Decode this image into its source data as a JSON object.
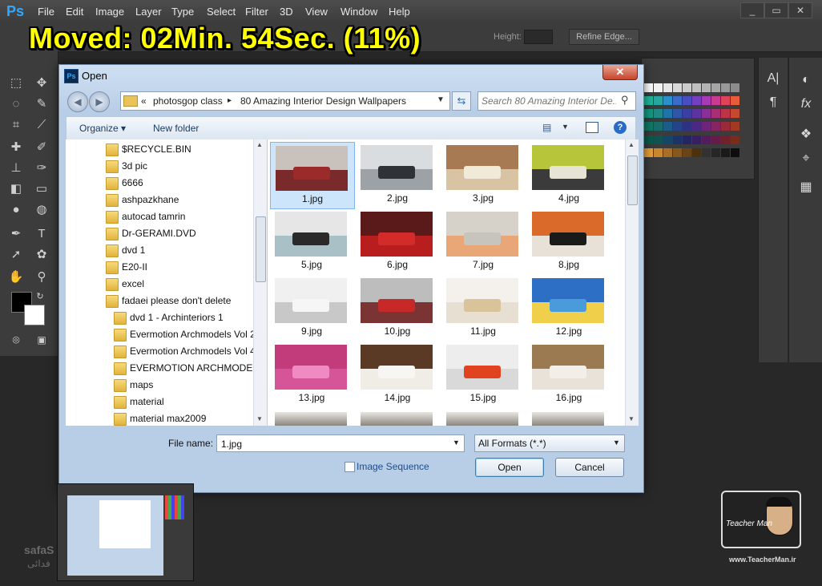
{
  "app": {
    "logo": "Ps",
    "menu": [
      "File",
      "Edit",
      "Image",
      "Layer",
      "Type",
      "Select",
      "Filter",
      "3D",
      "View",
      "Window",
      "Help"
    ],
    "window_buttons": [
      "_",
      "▭",
      "✕"
    ]
  },
  "overlay": {
    "banner": "Moved: 02Min. 54Sec. (11%)"
  },
  "options_bar": {
    "height_label": "Height:",
    "refine_edge": "Refine Edge..."
  },
  "tools": [
    "marquee-icon",
    "move-icon",
    "lasso-icon",
    "quick-select-icon",
    "crop-icon",
    "eyedropper-icon",
    "healing-icon",
    "brush-icon",
    "stamp-icon",
    "history-brush-icon",
    "eraser-icon",
    "gradient-icon",
    "blur-icon",
    "dodge-icon",
    "pen-icon",
    "type-icon",
    "path-select-icon",
    "shape-icon",
    "hand-icon",
    "zoom-icon"
  ],
  "tool_glyphs": {
    "type": "T",
    "type_alt": "A|",
    "paragraph": "¶",
    "fx": "fx"
  },
  "colors": {
    "foreground": "#000000",
    "background": "#ffffff",
    "ps_blue": "#31a8ff",
    "banner_yellow": "#ffff00"
  },
  "dialog": {
    "title": "Open",
    "address": {
      "chevron": "«",
      "parent": "photosgop class",
      "separator": "▸",
      "current": "80 Amazing Interior Design Wallpapers"
    },
    "search_placeholder": "Search 80 Amazing Interior De...",
    "organize": "Organize ▾",
    "new_folder": "New folder",
    "help": "?",
    "folders": [
      "$RECYCLE.BIN",
      "3d pic",
      "6666",
      "ashpazkhane",
      "autocad tamrin",
      "Dr-GERAMI.DVD",
      "dvd 1",
      "E20-II",
      "excel",
      "fadaei please don't delete",
      "dvd 1 - Archinteriors 1",
      "Evermotion Archmodels Vol 2",
      "Evermotion Archmodels Vol 4",
      "EVERMOTION ARCHMODELS",
      "maps",
      "material",
      "material max2009"
    ],
    "files": [
      {
        "name": "1.jpg",
        "top": "#c9c1bb",
        "bottom": "#7a2a2a",
        "obj": "#9b2b2b"
      },
      {
        "name": "2.jpg",
        "top": "#d9dde0",
        "bottom": "#9da2a6",
        "obj": "#2f3236"
      },
      {
        "name": "3.jpg",
        "top": "#a77a53",
        "bottom": "#d8c4a3",
        "obj": "#f1ead8"
      },
      {
        "name": "4.jpg",
        "top": "#b7c53a",
        "bottom": "#3b3b3b",
        "obj": "#e7e4d6"
      },
      {
        "name": "5.jpg",
        "top": "#e6e6e6",
        "bottom": "#a9c0c7",
        "obj": "#2a2a2a"
      },
      {
        "name": "6.jpg",
        "top": "#5b1a1a",
        "bottom": "#b81e1e",
        "obj": "#d32a2a"
      },
      {
        "name": "7.jpg",
        "top": "#d7d2c9",
        "bottom": "#e9a778",
        "obj": "#c7c3bd"
      },
      {
        "name": "8.jpg",
        "top": "#d96a2a",
        "bottom": "#e8e1d8",
        "obj": "#1a1a1a"
      },
      {
        "name": "9.jpg",
        "top": "#f0f0f0",
        "bottom": "#c8c8c8",
        "obj": "#f6f6f6"
      },
      {
        "name": "10.jpg",
        "top": "#bdbdbd",
        "bottom": "#7b3434",
        "obj": "#c72929"
      },
      {
        "name": "11.jpg",
        "top": "#f4f1ec",
        "bottom": "#e7dfd2",
        "obj": "#d9c39a"
      },
      {
        "name": "12.jpg",
        "top": "#2c6fc4",
        "bottom": "#f0d04a",
        "obj": "#4a9bdb"
      },
      {
        "name": "13.jpg",
        "top": "#c23b7a",
        "bottom": "#d65598",
        "obj": "#f08ac2"
      },
      {
        "name": "14.jpg",
        "top": "#5a3a24",
        "bottom": "#f0ece6",
        "obj": "#f8f6f2"
      },
      {
        "name": "15.jpg",
        "top": "#ededed",
        "bottom": "#d9d9d9",
        "obj": "#e2431f"
      },
      {
        "name": "16.jpg",
        "top": "#9b7a52",
        "bottom": "#e8e2d8",
        "obj": "#f2efe8"
      }
    ],
    "filename_label": "File name:",
    "filename_value": "1.jpg",
    "format_value": "All Formats (*.*)",
    "image_sequence": "Image Sequence",
    "open_btn": "Open",
    "cancel_btn": "Cancel"
  },
  "watermarks": {
    "safa": "safaS",
    "safa_sub": "فدائی",
    "teacherman": "Teacher Man",
    "url": "www.TeacherMan.ir"
  }
}
